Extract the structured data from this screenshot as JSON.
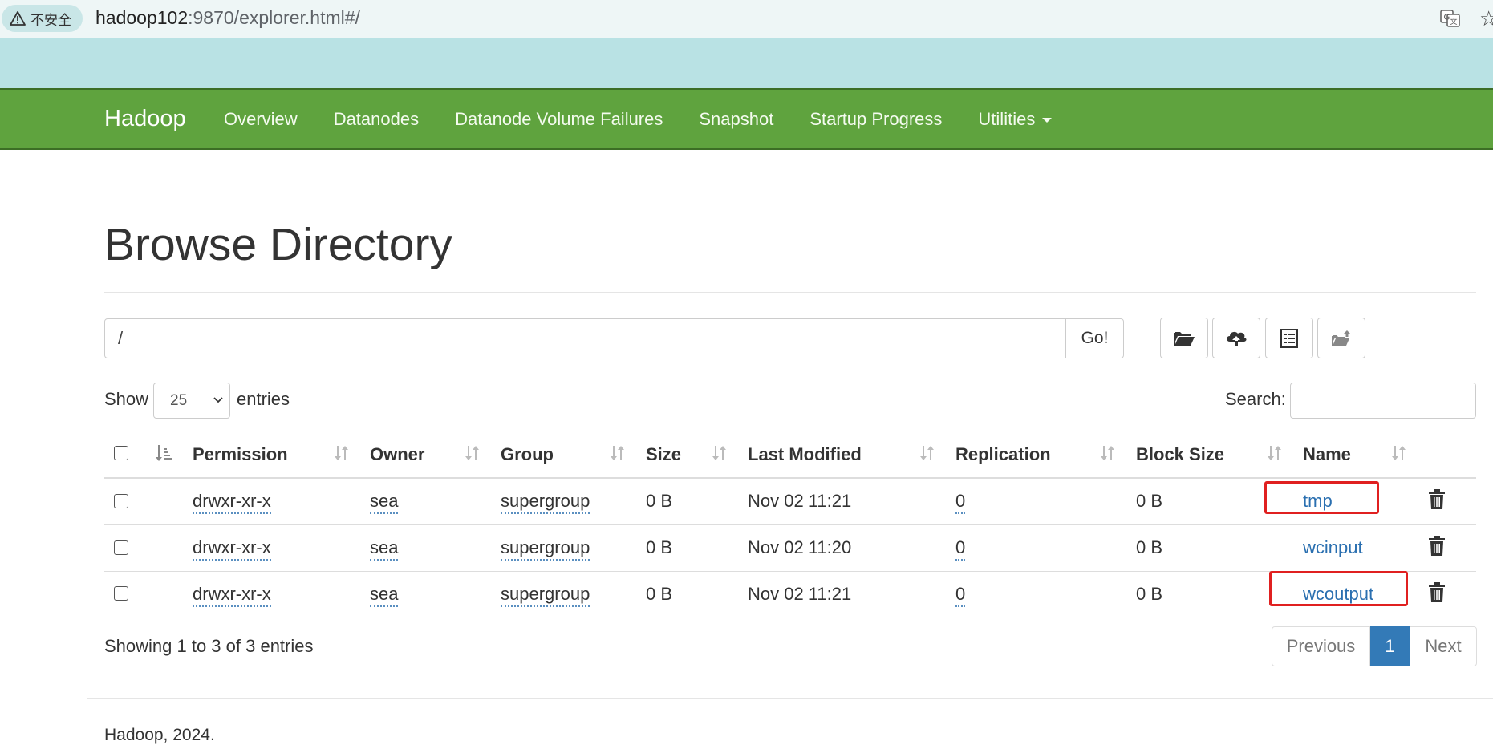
{
  "browser": {
    "security_label": "不安全",
    "url_host": "hadoop102",
    "url_rest": ":9870/explorer.html#/"
  },
  "navbar": {
    "brand": "Hadoop",
    "links": [
      "Overview",
      "Datanodes",
      "Datanode Volume Failures",
      "Snapshot",
      "Startup Progress",
      "Utilities"
    ]
  },
  "page": {
    "title": "Browse Directory",
    "path_value": "/",
    "go_label": "Go!",
    "show_label": "Show",
    "entries_value": "25",
    "entries_label": "entries",
    "search_label": "Search:",
    "search_value": ""
  },
  "table": {
    "columns": [
      "Permission",
      "Owner",
      "Group",
      "Size",
      "Last Modified",
      "Replication",
      "Block Size",
      "Name"
    ],
    "rows": [
      {
        "permission": "drwxr-xr-x",
        "owner": "sea",
        "group": "supergroup",
        "size": "0 B",
        "modified": "Nov 02 11:21",
        "replication": "0",
        "block_size": "0 B",
        "name": "tmp",
        "highlighted": true
      },
      {
        "permission": "drwxr-xr-x",
        "owner": "sea",
        "group": "supergroup",
        "size": "0 B",
        "modified": "Nov 02 11:20",
        "replication": "0",
        "block_size": "0 B",
        "name": "wcinput",
        "highlighted": false
      },
      {
        "permission": "drwxr-xr-x",
        "owner": "sea",
        "group": "supergroup",
        "size": "0 B",
        "modified": "Nov 02 11:21",
        "replication": "0",
        "block_size": "0 B",
        "name": "wcoutput",
        "highlighted": true
      }
    ]
  },
  "pagination": {
    "summary": "Showing 1 to 3 of 3 entries",
    "previous": "Previous",
    "current": "1",
    "next": "Next"
  },
  "footer": {
    "text": "Hadoop, 2024."
  },
  "colors": {
    "navbar": "#5fa33e",
    "link": "#2a6fb0",
    "highlight_box": "#e02020",
    "page_active": "#337ab7"
  }
}
